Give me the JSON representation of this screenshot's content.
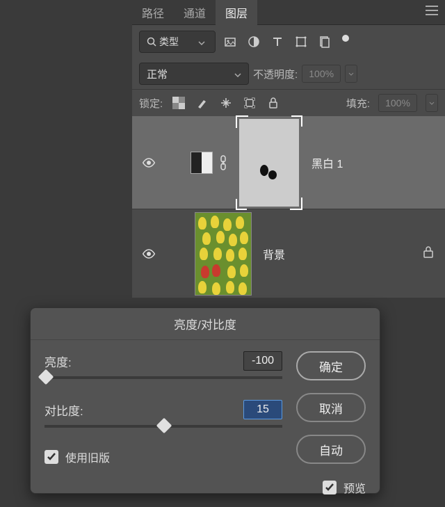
{
  "tabs": {
    "path": "路径",
    "channel": "通道",
    "layer": "图层"
  },
  "filter": {
    "label": "类型"
  },
  "blend": {
    "mode": "正常",
    "opacity_label": "不透明度:",
    "opacity_value": "100%"
  },
  "lock": {
    "label": "锁定:",
    "fill_label": "填充:",
    "fill_value": "100%"
  },
  "layers": [
    {
      "name": "黑白 1"
    },
    {
      "name": "背景"
    }
  ],
  "dialog": {
    "title": "亮度/对比度",
    "brightness": {
      "label": "亮度:",
      "value": "-100"
    },
    "contrast": {
      "label": "对比度:",
      "value": "15"
    },
    "legacy": "使用旧版",
    "ok": "确定",
    "cancel": "取消",
    "auto": "自动",
    "preview": "预览"
  }
}
